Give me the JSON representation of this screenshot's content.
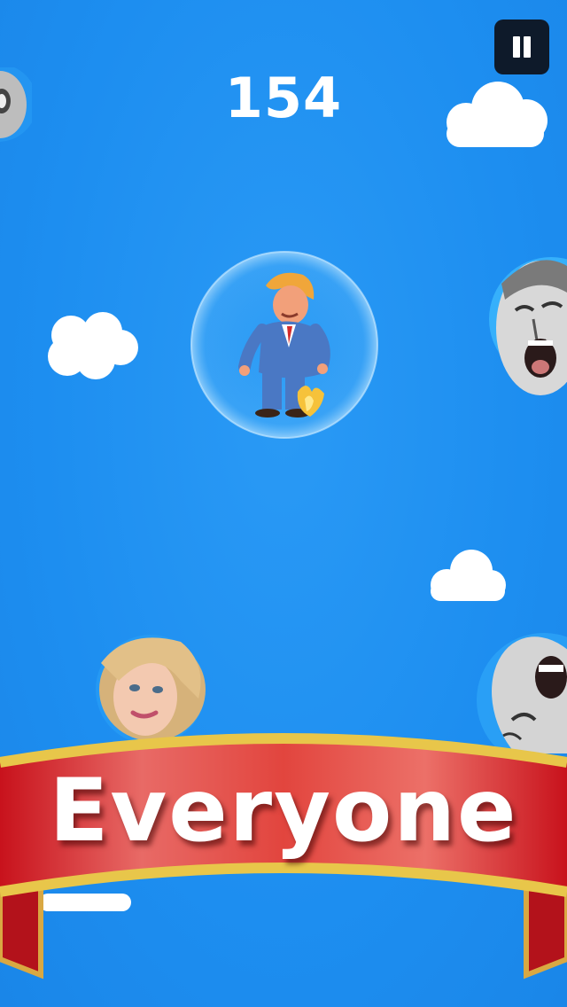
{
  "hud": {
    "score": "154",
    "pause_icon": "pause-icon"
  },
  "banner": {
    "label": "Everyone"
  },
  "colors": {
    "sky": "#1e90f2",
    "banner_red": "#d41f26",
    "banner_gold": "#e8c64a",
    "pause_bg": "#0e1a2a"
  },
  "player": {
    "character": "cartoon-politician-in-blue-suit",
    "shield": "bubble",
    "jetpack": "flame"
  },
  "enemies": [
    "face-top-left",
    "face-right-shouting",
    "face-blonde-woman",
    "face-bottom-right-shouting"
  ]
}
